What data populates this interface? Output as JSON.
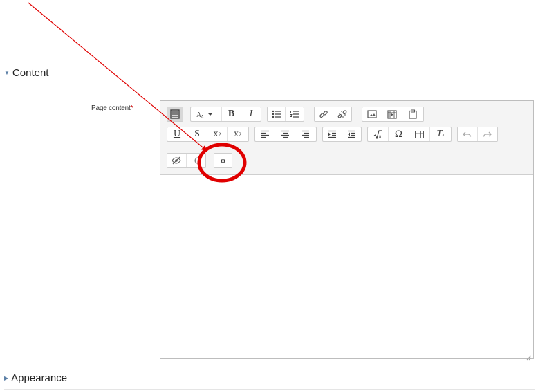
{
  "sections": {
    "content": {
      "title": "Content",
      "expanded": true
    },
    "appearance": {
      "title": "Appearance",
      "expanded": false
    }
  },
  "field": {
    "label": "Page content",
    "required_mark": "*"
  },
  "toolbar": {
    "row1": [
      "toolbar-toggle",
      "paragraph-styles",
      "bold",
      "italic",
      "bullet-list",
      "numbered-list",
      "link",
      "unlink",
      "image",
      "media",
      "manage-files"
    ],
    "row2": [
      "underline",
      "strikethrough",
      "subscript",
      "superscript",
      "align-left",
      "align-center",
      "align-right",
      "indent",
      "outdent",
      "equation",
      "special-character",
      "table",
      "clear-formatting",
      "undo",
      "redo"
    ],
    "row3": [
      "accessibility-checker",
      "screenreader-helper",
      "html-source"
    ],
    "labels": {
      "bold": "B",
      "italic": "I",
      "underline": "U",
      "strike": "S",
      "sub_base": "x",
      "sub_index": "2",
      "sup_base": "x",
      "sup_index": "2",
      "omega": "Ω",
      "clear_base": "T",
      "clear_index": "x",
      "html": "‹›"
    }
  },
  "annotation": {
    "color": "#e00000",
    "highlighted_button": "html-source"
  }
}
